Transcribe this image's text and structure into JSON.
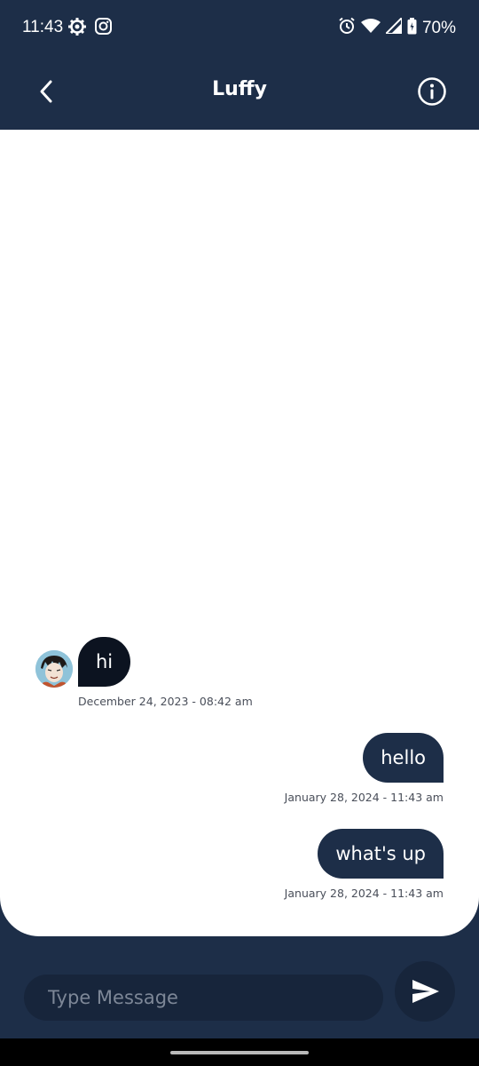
{
  "status_bar": {
    "time": "11:43",
    "battery": "70%",
    "icons": [
      "settings-gear-icon",
      "instagram-icon",
      "alarm-icon",
      "wifi-icon",
      "signal-icon",
      "battery-icon"
    ]
  },
  "header": {
    "title": "Luffy",
    "back_icon": "chevron-left-icon",
    "info_icon": "info-circle-icon"
  },
  "messages": [
    {
      "direction": "incoming",
      "text": "hi",
      "timestamp": "December 24, 2023 - 08:42 am"
    },
    {
      "direction": "outgoing",
      "text": "hello",
      "timestamp": "January 28, 2024 - 11:43 am"
    },
    {
      "direction": "outgoing",
      "text": "what's up",
      "timestamp": "January 28, 2024 - 11:43 am"
    }
  ],
  "composer": {
    "placeholder": "Type Message",
    "value": "",
    "send_icon": "send-icon"
  },
  "colors": {
    "primary": "#1d2e48",
    "incoming_bubble": "#0c1320",
    "outgoing_bubble": "#1d2e48",
    "background": "#ffffff"
  }
}
